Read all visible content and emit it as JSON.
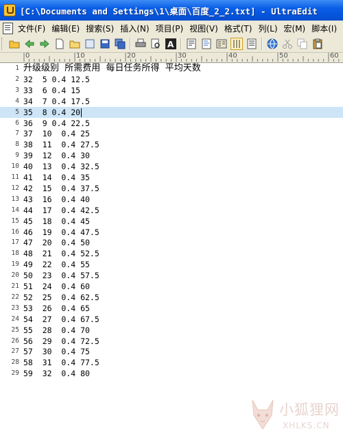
{
  "window": {
    "title": "[C:\\Documents and Settings\\1\\桌面\\百度_2_2.txt] - UltraEdit"
  },
  "menu": [
    {
      "label": "文件(F)",
      "name": "menu-file"
    },
    {
      "label": "编辑(E)",
      "name": "menu-edit"
    },
    {
      "label": "搜索(S)",
      "name": "menu-search"
    },
    {
      "label": "插入(N)",
      "name": "menu-insert"
    },
    {
      "label": "项目(P)",
      "name": "menu-project"
    },
    {
      "label": "视图(V)",
      "name": "menu-view"
    },
    {
      "label": "格式(T)",
      "name": "menu-format"
    },
    {
      "label": "列(L)",
      "name": "menu-column"
    },
    {
      "label": "宏(M)",
      "name": "menu-macro"
    },
    {
      "label": "脚本(I)",
      "name": "menu-script"
    }
  ],
  "ruler": {
    "labels": [
      "0",
      "10",
      "20",
      "30",
      "40",
      "50",
      "60"
    ]
  },
  "editor": {
    "current_line": 5,
    "lines": [
      "升级级别  所需费用  每日任务所得  平均天数",
      "32  5 0.4 12.5",
      "33  6 0.4 15",
      "34  7 0.4 17.5",
      "35  8 0.4 20",
      "36  9 0.4 22.5",
      "37  10  0.4 25",
      "38  11  0.4 27.5",
      "39  12  0.4 30",
      "40  13  0.4 32.5",
      "41  14  0.4 35",
      "42  15  0.4 37.5",
      "43  16  0.4 40",
      "44  17  0.4 42.5",
      "45  18  0.4 45",
      "46  19  0.4 47.5",
      "47  20  0.4 50",
      "48  21  0.4 52.5",
      "49  22  0.4 55",
      "50  23  0.4 57.5",
      "51  24  0.4 60",
      "52  25  0.4 62.5",
      "53  26  0.4 65",
      "54  27  0.4 67.5",
      "55  28  0.4 70",
      "56  29  0.4 72.5",
      "57  30  0.4 75",
      "58  31  0.4 77.5",
      "59  32  0.4 80"
    ]
  },
  "watermark": {
    "text": "小狐狸网",
    "url": "XHLKS.CN"
  }
}
